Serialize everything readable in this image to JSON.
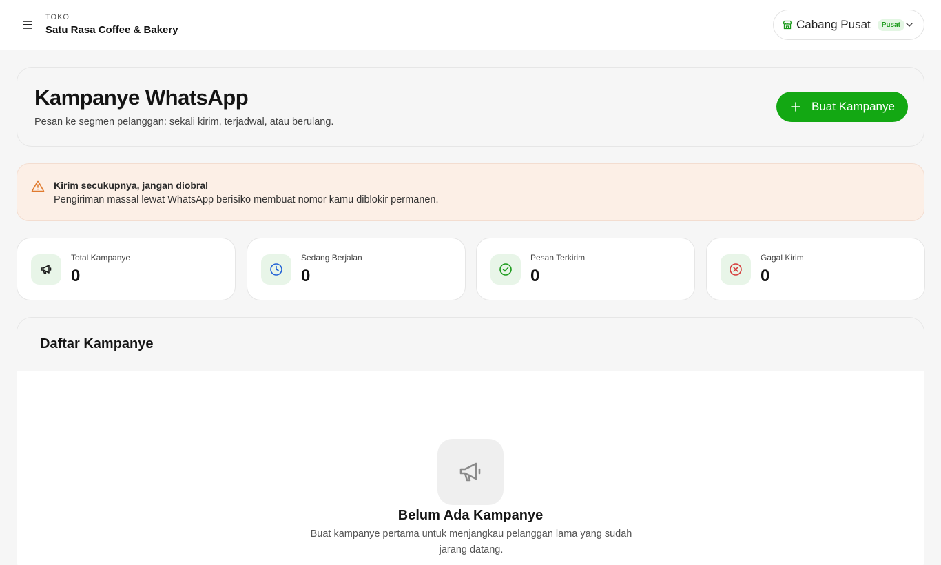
{
  "topbar": {
    "store_label": "TOKO",
    "store_name": "Satu Rasa Coffee & Bakery",
    "branch": {
      "name": "Cabang Pusat",
      "badge": "Pusat"
    }
  },
  "header": {
    "title": "Kampanye WhatsApp",
    "subtitle": "Pesan ke segmen pelanggan: sekali kirim, terjadwal, atau berulang.",
    "create_button": "Buat Kampanye"
  },
  "warning": {
    "title": "Kirim secukupnya, jangan diobral",
    "text": "Pengiriman massal lewat WhatsApp berisiko membuat nomor kamu diblokir permanen."
  },
  "stats": [
    {
      "label": "Total Kampanye",
      "value": "0",
      "icon": "megaphone-icon",
      "color": "#1a1a1a"
    },
    {
      "label": "Sedang Berjalan",
      "value": "0",
      "icon": "clock-icon",
      "color": "#2463d6"
    },
    {
      "label": "Pesan Terkirim",
      "value": "0",
      "icon": "check-circle-icon",
      "color": "#1a9a1a"
    },
    {
      "label": "Gagal Kirim",
      "value": "0",
      "icon": "x-circle-icon",
      "color": "#d63b3b"
    }
  ],
  "list": {
    "title": "Daftar Kampanye",
    "empty_title": "Belum Ada Kampanye",
    "empty_text": "Buat kampanye pertama untuk menjangkau pelanggan lama yang sudah jarang datang."
  },
  "colors": {
    "accent": "#13a813",
    "warning_bg": "#fcefe6",
    "warning_icon": "#e07a2e"
  }
}
